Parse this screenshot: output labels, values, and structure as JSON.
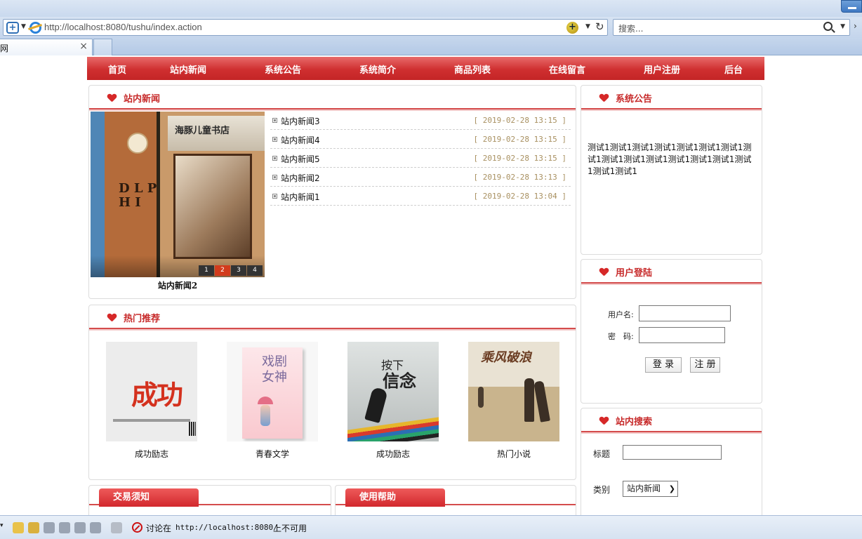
{
  "browser": {
    "url": "http://localhost:8080/tushu/index.action",
    "search_placeholder": "搜索...",
    "tab_title": "书网"
  },
  "nav": [
    "首页",
    "站内新闻",
    "系统公告",
    "系统简介",
    "商品列表",
    "在线留言",
    "用户注册",
    "后台"
  ],
  "news": {
    "title": "站内新闻",
    "slideshow_caption": "站内新闻2",
    "slide_sign": "海豚儿童书店",
    "slide_pages": [
      "1",
      "2",
      "3",
      "4"
    ],
    "active_page": 2,
    "items": [
      {
        "title": "站内新闻3",
        "date": "[ 2019-02-28 13:15 ]"
      },
      {
        "title": "站内新闻4",
        "date": "[ 2019-02-28 13:15 ]"
      },
      {
        "title": "站内新闻5",
        "date": "[ 2019-02-28 13:15 ]"
      },
      {
        "title": "站内新闻2",
        "date": "[ 2019-02-28 13:13 ]"
      },
      {
        "title": "站内新闻1",
        "date": "[ 2019-02-28 13:04 ]"
      }
    ]
  },
  "notice": {
    "title": "系统公告",
    "text": "测试1测试1测试1测试1测试1测试1测试1测试1测试1测试1测试1测试1测试1测试1测试1测试1测试1"
  },
  "login": {
    "title": "用户登陆",
    "username_label": "用户名:",
    "password_label": "密　码:",
    "login_button": "登 录",
    "register_button": "注 册"
  },
  "hot": {
    "title": "热门推荐",
    "books": [
      {
        "label": "成功励志",
        "cover_text": "成功"
      },
      {
        "label": "青春文学",
        "cover_text": "戏剧女神"
      },
      {
        "label": "成功励志",
        "cover_text_top": "按下",
        "cover_text_main": "信念"
      },
      {
        "label": "热门小说",
        "cover_text": "乘风破浪"
      }
    ]
  },
  "trade_tab": "交易须知",
  "help_tab": "使用帮助",
  "search": {
    "title": "站内搜索",
    "title_label": "标题",
    "category_label": "类别",
    "category_value": "站内新闻"
  },
  "statusbar": {
    "text1": "讨论在",
    "url": "http://localhost:8080/",
    "text2": "上不可用"
  },
  "colors": {
    "nav_red": "#cf2f30",
    "heading_red": "#c72a2a",
    "date_color": "#a89060"
  }
}
